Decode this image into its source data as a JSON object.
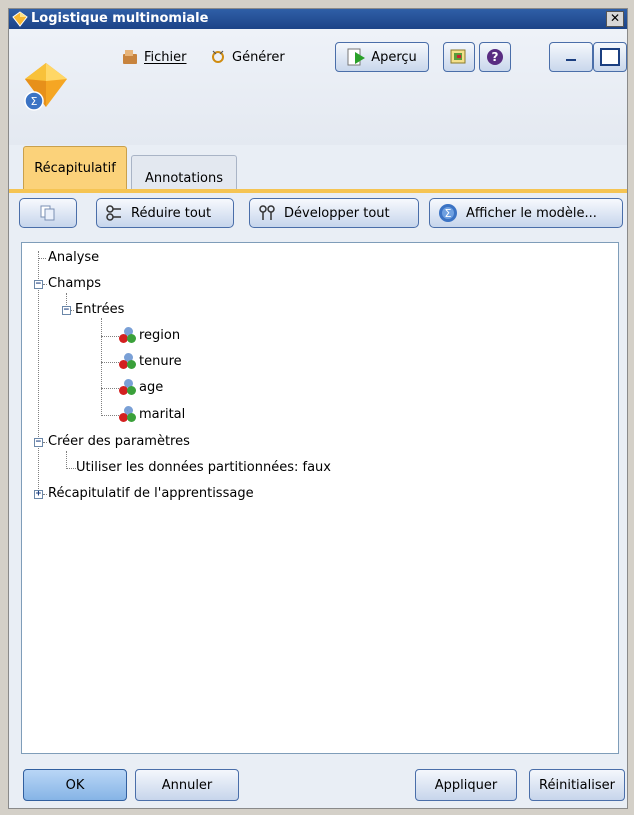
{
  "window": {
    "title": "Logistique multinomiale",
    "close_glyph": "✕"
  },
  "menu": {
    "file": "Fichier",
    "generate": "Générer",
    "preview": "Aperçu"
  },
  "tabs": [
    {
      "label": "Récapitulatif",
      "active": true
    },
    {
      "label": "Annotations",
      "active": false
    }
  ],
  "toolbar": {
    "collapse_all": "Réduire tout",
    "expand_all": "Développer tout",
    "show_model": "Afficher le modèle..."
  },
  "tree": {
    "analysis": "Analyse",
    "fields": "Champs",
    "inputs": "Entrées",
    "input_fields": [
      "region",
      "tenure",
      "age",
      "marital"
    ],
    "build_settings": "Créer des paramètres",
    "partitioned": "Utiliser les données partitionnées: faux",
    "training_summary": "Récapitulatif de l'apprentissage"
  },
  "footer": {
    "ok": "OK",
    "cancel": "Annuler",
    "apply": "Appliquer",
    "reset": "Réinitialiser"
  },
  "colors": {
    "title_bar": "#1c4387",
    "active_tab": "#fbd27a",
    "accent_rule": "#f5c453"
  }
}
